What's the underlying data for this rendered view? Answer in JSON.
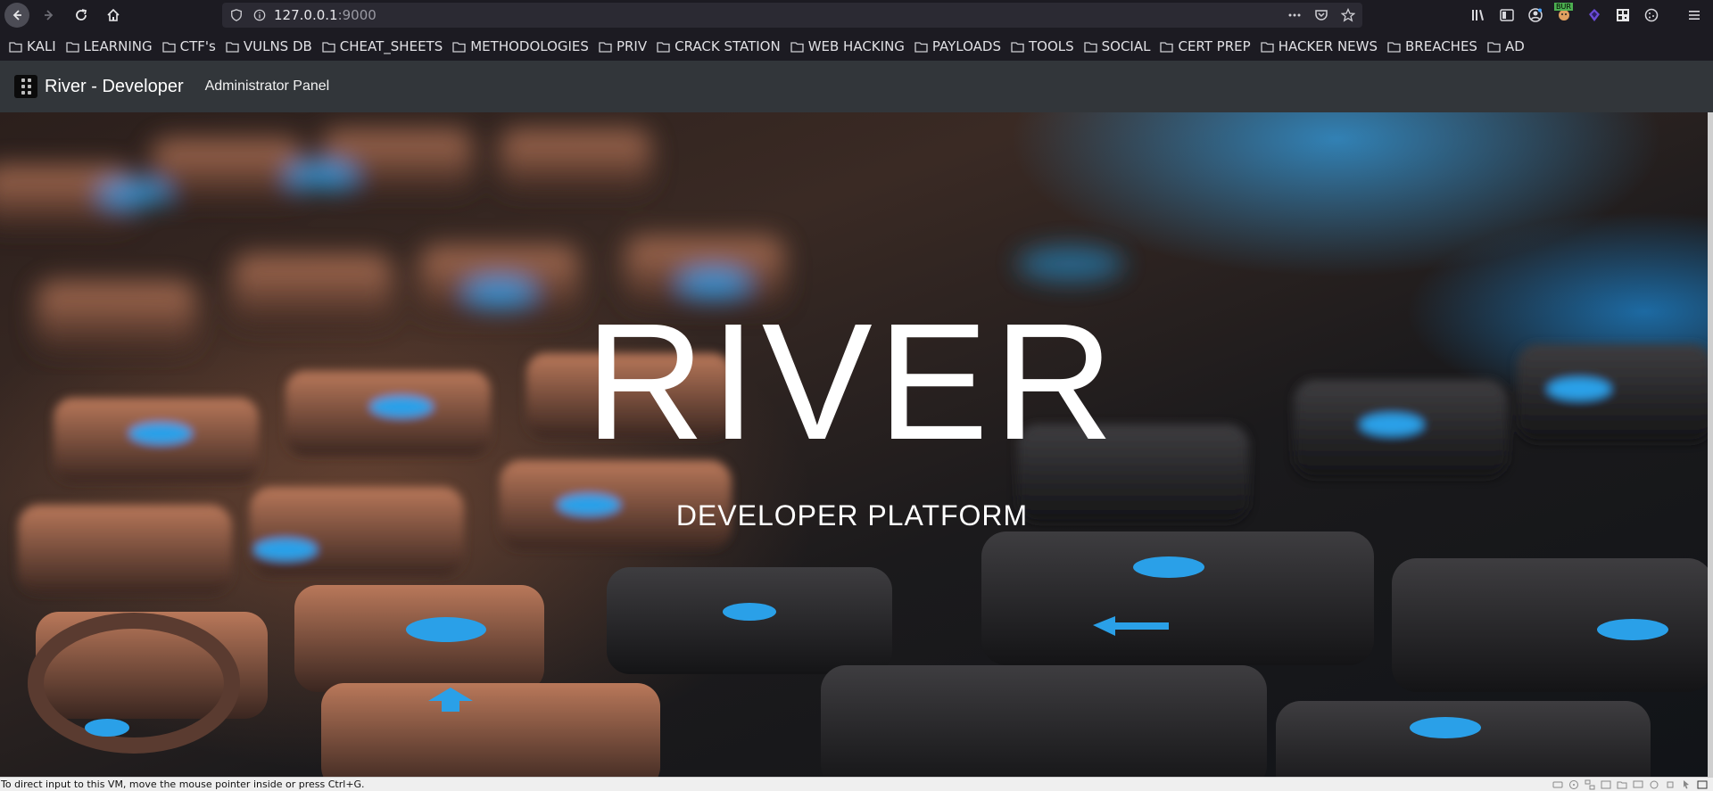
{
  "browser": {
    "url": {
      "host": "127.0.0.1",
      "port": ":9000"
    },
    "bookmarks": [
      "KALI",
      "LEARNING",
      "CTF's",
      "VULNS DB",
      "CHEAT_SHEETS",
      "METHODOLOGIES",
      "PRIV",
      "CRACK STATION",
      "WEB HACKING",
      "PAYLOADS",
      "TOOLS",
      "SOCIAL",
      "CERT PREP",
      "HACKER NEWS",
      "BREACHES",
      "AD"
    ],
    "extension_badge": "BUR"
  },
  "navbar": {
    "brand": "River - Developer",
    "link": "Administrator Panel"
  },
  "hero": {
    "title": "RIVER",
    "subtitle": "DEVELOPER PLATFORM"
  },
  "status_bar": {
    "message": "To direct input to this VM, move the mouse pointer inside or press Ctrl+G."
  },
  "icons": {
    "back": "arrow-left-icon",
    "forward": "arrow-right-icon",
    "reload": "reload-icon",
    "home": "home-icon",
    "shield": "shield-icon",
    "info": "info-icon",
    "more": "ellipsis-icon",
    "pocket": "pocket-icon",
    "star": "bookmark-star-icon",
    "library": "library-icon",
    "sidebar": "sidebar-icon",
    "account": "account-icon",
    "menu": "hamburger-menu-icon",
    "folder": "folder-icon"
  },
  "colors": {
    "toolbar": "#1c1b22",
    "urlbar": "#2b2a33",
    "navbar": "#32363a",
    "accent_blue": "#1e9be6"
  }
}
